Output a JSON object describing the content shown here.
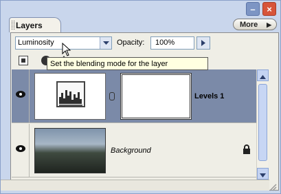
{
  "window": {
    "minimize_icon": "minimize-icon",
    "close_icon": "close-icon",
    "accent": "#c9d6ec",
    "close_color": "#d7553a"
  },
  "panel": {
    "tab_label": "Layers",
    "menu_label": "More"
  },
  "controls": {
    "blend_mode": "Luminosity",
    "opacity_label": "Opacity:",
    "opacity_value": "100%"
  },
  "tooltip": {
    "text": "Set the blending mode for the layer"
  },
  "layers": [
    {
      "name": "Levels 1",
      "selected": true,
      "visible": true,
      "type": "adjustment"
    },
    {
      "name": "Background",
      "selected": false,
      "visible": true,
      "locked": true,
      "type": "image"
    }
  ],
  "colors": {
    "selected_row": "#7b8aa8",
    "tooltip_bg": "#ffffe1"
  }
}
